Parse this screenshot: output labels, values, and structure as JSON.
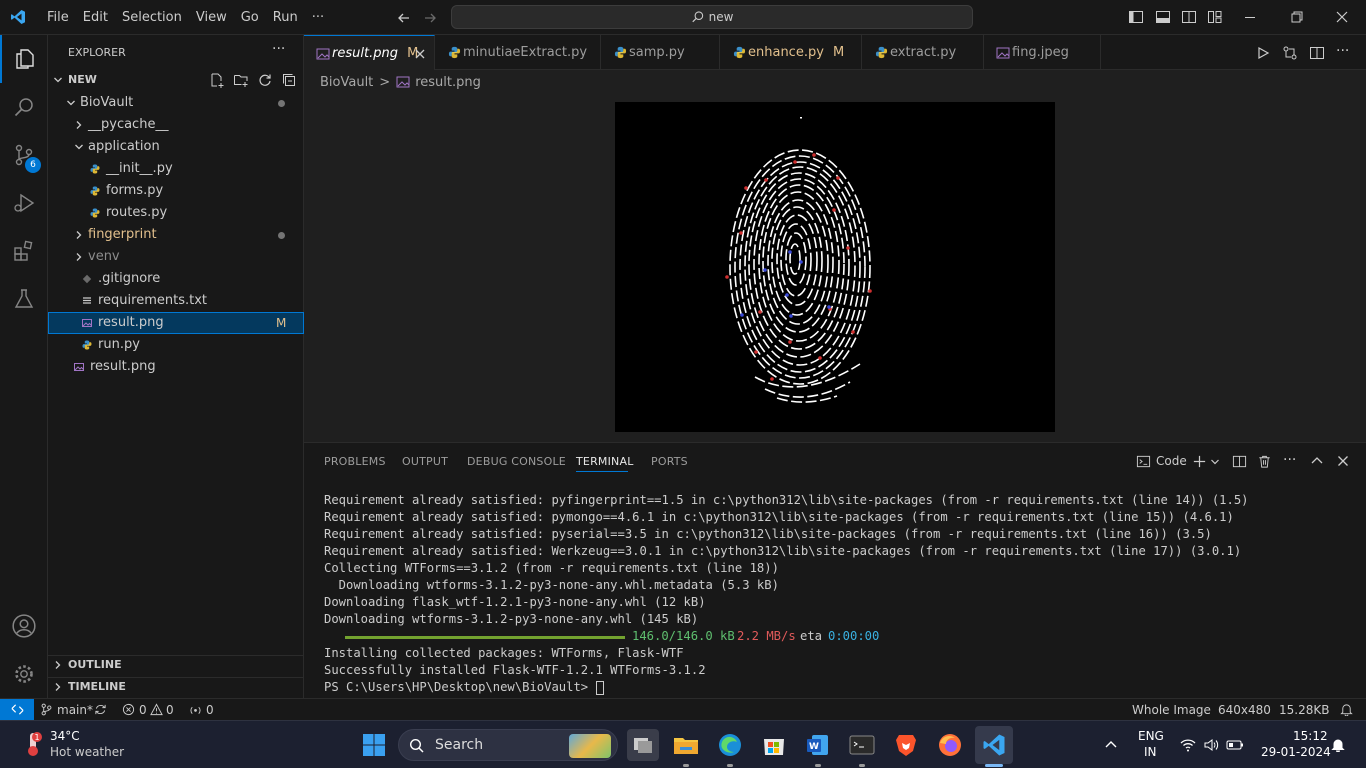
{
  "menu": {
    "items": [
      "File",
      "Edit",
      "Selection",
      "View",
      "Go",
      "Run",
      "···"
    ]
  },
  "search": {
    "text": "new"
  },
  "sidebar": {
    "title": "EXPLORER",
    "more": "···",
    "root": "NEW",
    "items": [
      {
        "label": "BioVault",
        "kind": "folder-open",
        "indent": 1,
        "dot": true
      },
      {
        "label": "__pycache__",
        "kind": "folder",
        "indent": 2
      },
      {
        "label": "application",
        "kind": "folder-open",
        "indent": 2
      },
      {
        "label": "__init__.py",
        "kind": "py",
        "indent": 3
      },
      {
        "label": "forms.py",
        "kind": "py",
        "indent": 3
      },
      {
        "label": "routes.py",
        "kind": "py",
        "indent": 3
      },
      {
        "label": "fingerprint",
        "kind": "folder",
        "indent": 2,
        "dot": true,
        "color": "#e2c08d"
      },
      {
        "label": "venv",
        "kind": "folder",
        "indent": 2,
        "color": "#8c8c8c"
      },
      {
        "label": ".gitignore",
        "kind": "git",
        "indent": 2
      },
      {
        "label": "requirements.txt",
        "kind": "txt",
        "indent": 2
      },
      {
        "label": "result.png",
        "kind": "img",
        "indent": 2,
        "badge": "M",
        "selected": true
      },
      {
        "label": "run.py",
        "kind": "py",
        "indent": 2
      },
      {
        "label": "result.png",
        "kind": "img",
        "indent": 1
      }
    ],
    "outline": "OUTLINE",
    "timeline": "TIMELINE"
  },
  "activity": {
    "scm_badge": "6"
  },
  "tabs": [
    {
      "label": "result.png",
      "badge": "M",
      "active": true
    },
    {
      "label": "minutiaeExtract.py"
    },
    {
      "label": "samp.py"
    },
    {
      "label": "enhance.py",
      "badge": "M",
      "modified": true
    },
    {
      "label": "extract.py"
    },
    {
      "label": "fing.jpeg"
    }
  ],
  "breadcrumb": {
    "root": "BioVault",
    "sep": ">",
    "file": "result.png"
  },
  "panel": {
    "tabs": [
      "PROBLEMS",
      "OUTPUT",
      "DEBUG CONSOLE",
      "TERMINAL",
      "PORTS"
    ],
    "shell": "Code"
  },
  "terminal": {
    "lines": [
      "Requirement already satisfied: pyfingerprint==1.5 in c:\\python312\\lib\\site-packages (from -r requirements.txt (line 14)) (1.5)",
      "Requirement already satisfied: pymongo==4.6.1 in c:\\python312\\lib\\site-packages (from -r requirements.txt (line 15)) (4.6.1)",
      "Requirement already satisfied: pyserial==3.5 in c:\\python312\\lib\\site-packages (from -r requirements.txt (line 16)) (3.5)",
      "Requirement already satisfied: Werkzeug==3.0.1 in c:\\python312\\lib\\site-packages (from -r requirements.txt (line 17)) (3.0.1)",
      "Collecting WTForms==3.1.2 (from -r requirements.txt (line 18))",
      "  Downloading wtforms-3.1.2-py3-none-any.whl.metadata (5.3 kB)",
      "Downloading flask_wtf-1.2.1-py3-none-any.whl (12 kB)",
      "Downloading wtforms-3.1.2-py3-none-any.whl (145 kB)"
    ],
    "progress": {
      "size": "146.0/146.0 kB",
      "speed": "2.2 MB/s",
      "eta_label": "eta",
      "eta": "0:00:00"
    },
    "after": [
      "Installing collected packages: WTForms, Flask-WTF",
      "Successfully installed Flask-WTF-1.2.1 WTForms-3.1.2"
    ],
    "prompt": "PS C:\\Users\\HP\\Desktop\\new\\BioVault> "
  },
  "status": {
    "branch": "main*",
    "errors": "0",
    "warnings": "0",
    "ports": "0",
    "view": "Whole Image",
    "dims": "640x480",
    "size": "15.28KB"
  },
  "taskbar": {
    "temp": "34°C",
    "weather": "Hot weather",
    "search": "Search",
    "lang1": "ENG",
    "lang2": "IN",
    "time": "15:12",
    "date": "29-01-2024"
  },
  "colors": {
    "accent": "#0078d4",
    "modified": "#e2c08d",
    "badge": "#0078d4"
  }
}
